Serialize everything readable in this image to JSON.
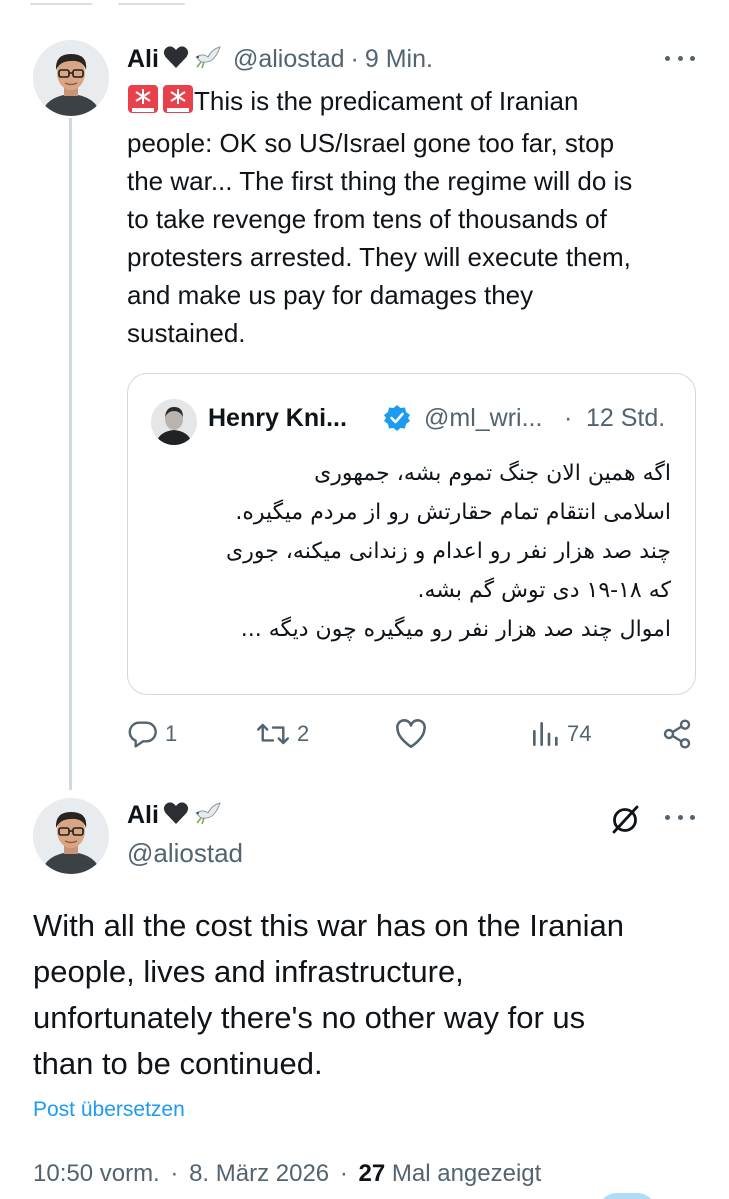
{
  "reply_tweet": {
    "author_name": "Ali",
    "handle": "@aliostad",
    "separator": "·",
    "time": "9 Min.",
    "text_lines": [
      "This is the predicament of Iranian",
      "people: OK so US/Israel gone too far, stop",
      "the war... The first thing the regime will do is",
      "to take revenge from tens of thousands of",
      "protesters arrested. They will execute them,",
      "and make us pay for damages they",
      "sustained."
    ],
    "quote": {
      "author_name": "Henry Kni...",
      "handle": "@ml_wri...",
      "separator": "·",
      "time": "12 Std.",
      "text_lines": [
        "اگه همین الان جنگ تموم بشه، جمهوری",
        "اسلامی انتقام تمام حقارتش رو از مردم میگیره.",
        "چند صد هزار نفر رو اعدام و زندانی میکنه، جوری",
        "که ۱۸-۱۹ دی توش گم بشه.",
        "اموال چند صد هزار نفر رو میگیره چون دیگه ..."
      ]
    },
    "actions": {
      "replies": "1",
      "reposts": "2",
      "views": "74"
    }
  },
  "main_tweet": {
    "author_name": "Ali",
    "handle": "@aliostad",
    "text_lines": [
      "With all the cost this war has on the Iranian",
      "people, lives and infrastructure,",
      "unfortunately there's no other way for us",
      "than to be continued."
    ],
    "translate_label": "Post übersetzen",
    "meta": {
      "time": "10:50 vorm.",
      "separator1": "·",
      "date": "8. März 2026",
      "separator2": "·",
      "views_count": "27",
      "views_label": "Mal angezeigt"
    }
  },
  "colors": {
    "text": "#0f1419",
    "secondary": "#536471",
    "accent": "#1d9bf0",
    "border": "#cfd9de"
  }
}
